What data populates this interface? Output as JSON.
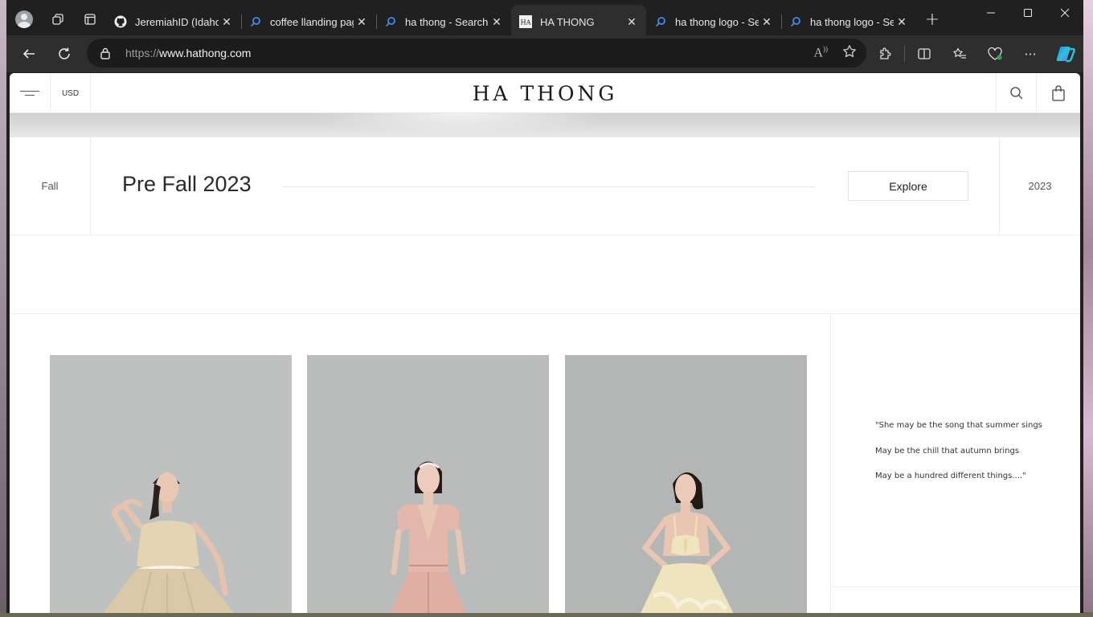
{
  "browser": {
    "tabs": [
      {
        "title": "JeremiahID (Idahos",
        "favicon": "github-icon"
      },
      {
        "title": "coffee llanding pag",
        "favicon": "search-icon"
      },
      {
        "title": "ha thong - Search",
        "favicon": "search-icon"
      },
      {
        "title": "HA THONG",
        "favicon": "ha-thong-icon",
        "active": true
      },
      {
        "title": "ha thong logo - Se",
        "favicon": "search-icon"
      },
      {
        "title": "ha thong logo - Se",
        "favicon": "search-icon"
      }
    ],
    "address": {
      "scheme": "https://",
      "host": "www.hathong.com"
    }
  },
  "site": {
    "currency": "USD",
    "logo": "HA THONG",
    "collection": {
      "season": "Fall",
      "title": "Pre Fall 2023",
      "explore_label": "Explore",
      "year": "2023"
    },
    "quote": [
      "\"She may be the song that summer sings",
      "May be the chill that autumn brings",
      "May be a hundred different things....\""
    ],
    "gallery": [
      {
        "name": "champagne-gown-photo",
        "dress_color": "#d9c9a8",
        "bg": "#bfc1c0"
      },
      {
        "name": "pink-dress-photo",
        "dress_color": "#e4b7ac",
        "bg": "#b9bcbb"
      },
      {
        "name": "cream-two-piece-photo",
        "dress_color": "#eee4bd",
        "bg": "#b4b6b5"
      }
    ]
  }
}
